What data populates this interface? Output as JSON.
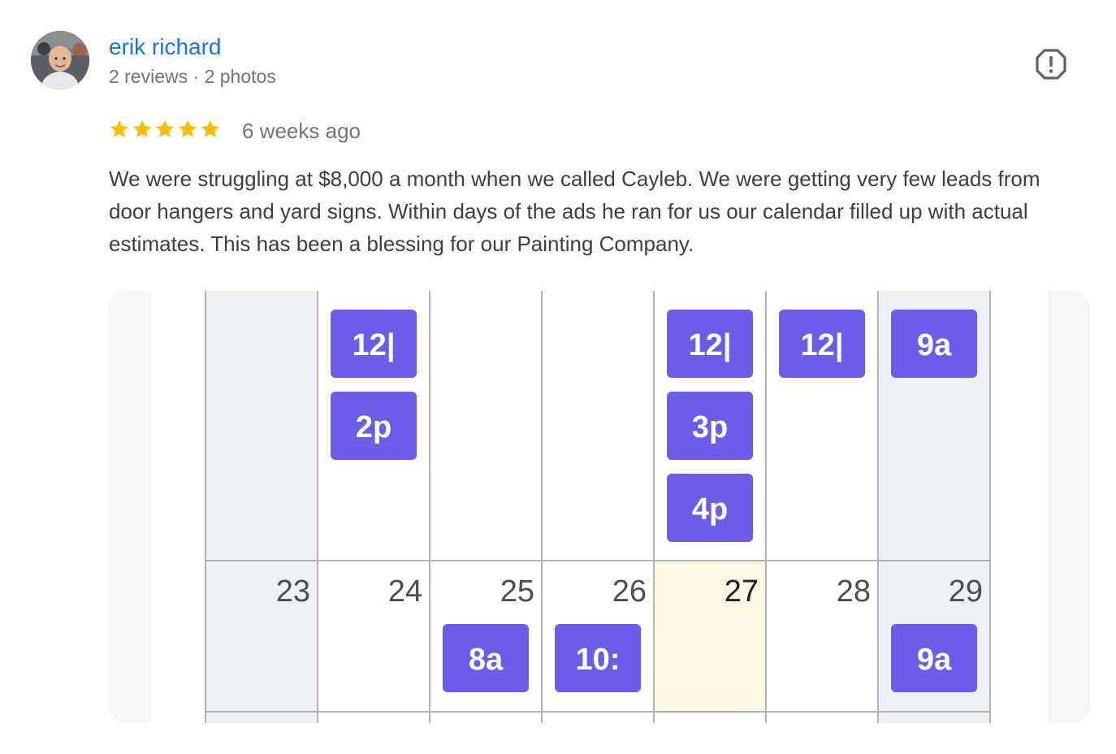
{
  "review": {
    "author_name": "erik richard",
    "author_meta": "2 reviews · 2 photos",
    "rating": 5,
    "rating_max": 5,
    "date": "6 weeks ago",
    "text": "We were struggling at $8,000 a month when we called Cayleb. We were getting very few leads from door hangers and yard signs. Within days of the ads he ran for us our calendar filled up with actual estimates. This has been a blessing for our Painting Company."
  },
  "icons": {
    "star": "star-icon",
    "report": "report-flag-icon",
    "avatar": "avatar"
  },
  "colors": {
    "link": "#1a73e8",
    "star": "#fbbc04",
    "event": "#6c5ce7",
    "today": "#fdf8e4",
    "weekend": "#eef2f6"
  },
  "calendar": {
    "top_week": [
      {
        "events": []
      },
      {
        "events": [
          "12|",
          "2p"
        ]
      },
      {
        "events": []
      },
      {
        "events": []
      },
      {
        "events": [
          "12|",
          "3p",
          "4p"
        ]
      },
      {
        "events": [
          "12|"
        ]
      },
      {
        "events": [
          "9a"
        ]
      }
    ],
    "bottom_week": [
      {
        "day": "23",
        "events": []
      },
      {
        "day": "24",
        "events": []
      },
      {
        "day": "25",
        "events": [
          "8a"
        ]
      },
      {
        "day": "26",
        "events": [
          "10:"
        ]
      },
      {
        "day": "27",
        "events": [],
        "today": true
      },
      {
        "day": "28",
        "events": []
      },
      {
        "day": "29",
        "events": [
          "9a"
        ]
      }
    ]
  }
}
